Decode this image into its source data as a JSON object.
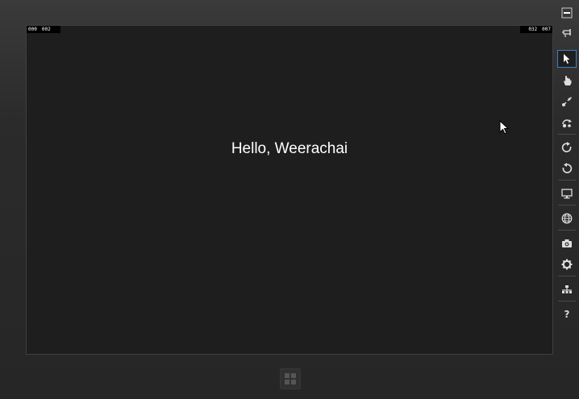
{
  "screen": {
    "counter_left": [
      "000",
      "002"
    ],
    "counter_right": [
      "032",
      "007"
    ],
    "greeting": "Hello, Weerachai"
  },
  "toolbar": {
    "items": [
      {
        "name": "minimize",
        "icon": "minimize-icon"
      },
      {
        "name": "always-on-top",
        "icon": "pin-icon"
      },
      {
        "name": "mouse-mode",
        "icon": "cursor-icon",
        "active": true
      },
      {
        "name": "basic-touch-mode",
        "icon": "hand-icon"
      },
      {
        "name": "pinch-zoom-mode",
        "icon": "pinch-icon"
      },
      {
        "name": "rotation-touch-mode",
        "icon": "rotate-touch-icon"
      },
      {
        "name": "rotate-clockwise",
        "icon": "rotate-cw-icon"
      },
      {
        "name": "rotate-counterclockwise",
        "icon": "rotate-ccw-icon"
      },
      {
        "name": "change-resolution",
        "icon": "monitor-icon"
      },
      {
        "name": "set-location",
        "icon": "globe-icon"
      },
      {
        "name": "screenshot",
        "icon": "camera-icon"
      },
      {
        "name": "screenshot-settings",
        "icon": "gear-icon"
      },
      {
        "name": "network-properties",
        "icon": "network-icon"
      },
      {
        "name": "help",
        "icon": "help-icon",
        "label": "?"
      }
    ]
  },
  "colors": {
    "active_outline": "#3b82c4",
    "screen_bg": "#1e1e1e",
    "bezel_bg": "#2a2a2a"
  }
}
